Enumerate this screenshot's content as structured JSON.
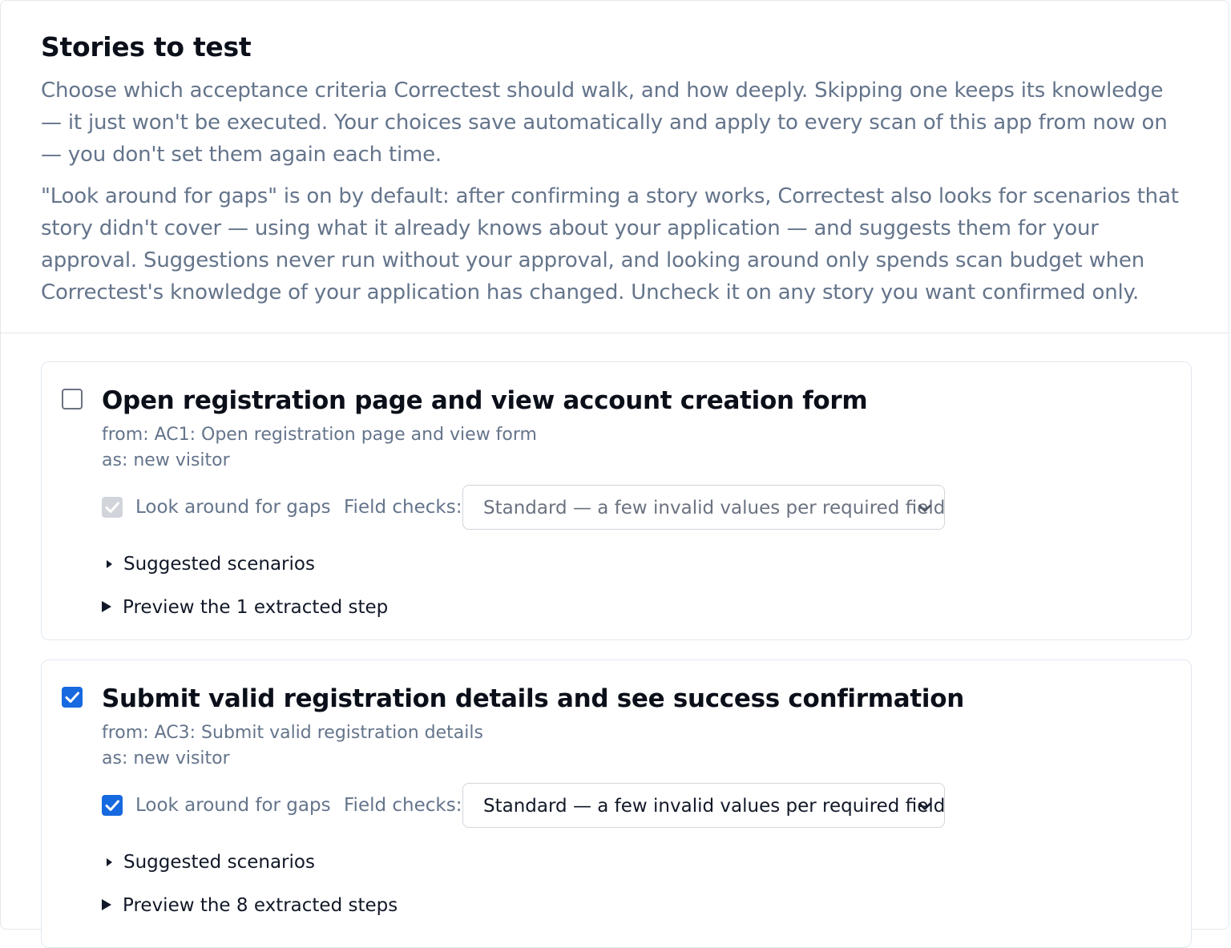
{
  "header": {
    "title": "Stories to test",
    "intro": "Choose which acceptance criteria Correctest should walk, and how deeply. Skipping one keeps its knowledge — it just won't be executed. Your choices save automatically and apply to every scan of this app from now on — you don't set them again each time.",
    "gaps_note": "\"Look around for gaps\" is on by default: after confirming a story works, Correctest also looks for scenarios that story didn't cover — using what it already knows about your application — and suggests them for your approval. Suggestions never run without your approval, and looking around only spends scan budget when Correctest's knowledge of your application has changed. Uncheck it on any story you want confirmed only."
  },
  "stories": [
    {
      "title": "Open registration page and view account creation form",
      "from": "from: AC1: Open registration page and view form",
      "as": "as: new visitor",
      "selected": false,
      "look_around_label": "Look around for gaps",
      "look_around_checked": true,
      "look_around_disabled": true,
      "field_checks_label": "Field checks:",
      "field_checks_value": "Standard — a few invalid values per required field",
      "suggested_label": "Suggested scenarios",
      "preview_label": "Preview the 1 extracted step"
    },
    {
      "title": "Submit valid registration details and see success confirmation",
      "from": "from: AC3: Submit valid registration details",
      "as": "as: new visitor",
      "selected": true,
      "look_around_label": "Look around for gaps",
      "look_around_checked": true,
      "look_around_disabled": false,
      "field_checks_label": "Field checks:",
      "field_checks_value": "Standard — a few invalid values per required field",
      "suggested_label": "Suggested scenarios",
      "preview_label": "Preview the 8 extracted steps"
    }
  ],
  "colors": {
    "accent": "#1769e0",
    "muted_text": "#64748b",
    "border": "#e2e8f0"
  }
}
